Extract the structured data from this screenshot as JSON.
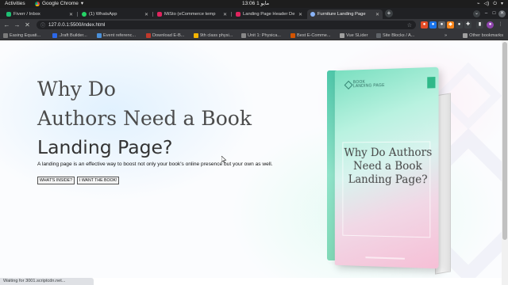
{
  "os": {
    "activities": "Activities",
    "app_name": "Google Chrome",
    "clock": "13:06  1 مايو"
  },
  "tabs": [
    {
      "title": "Fiverr / Inbox",
      "color": "#1dbf73"
    },
    {
      "title": "(1) WhatsApp",
      "color": "#25d366"
    },
    {
      "title": "MiSto (eCommerce temp",
      "color": "#e0245e"
    },
    {
      "title": "Landing Page Header De",
      "color": "#e0245e"
    },
    {
      "title": "Furniture Landing Page",
      "color": "#8ab4f8"
    }
  ],
  "omnibox": {
    "url": "127.0.0.1:5500/index.html"
  },
  "bookmarks": [
    {
      "label": "Easing Equati..."
    },
    {
      "label": ".Jraft Builder..."
    },
    {
      "label": "Event referenc..."
    },
    {
      "label": "Download E-B..."
    },
    {
      "label": "9th class physi..."
    },
    {
      "label": "Unit 1: Physica..."
    },
    {
      "label": "Best E-Comme..."
    },
    {
      "label": "Vue SLider"
    },
    {
      "label": "Site Blocks / A..."
    }
  ],
  "other_bookmarks": "Other bookmarks",
  "hero": {
    "line1": "Why Do",
    "line2": "Authors Need a Book",
    "line3": "Landing Page?",
    "lead": "A landing page is an effective way to boost not only your book's online presence but your own as well.",
    "cta_primary": "WHAT'S INSIDE?",
    "cta_secondary": "I WANT THE BOOK!"
  },
  "book": {
    "logo_line1": "BOOK",
    "logo_line2": "LANDING PAGE",
    "title": "Why Do Authors Need a Book Landing Page?"
  },
  "status": "Waiting for 3001.scriptcdn.net..."
}
